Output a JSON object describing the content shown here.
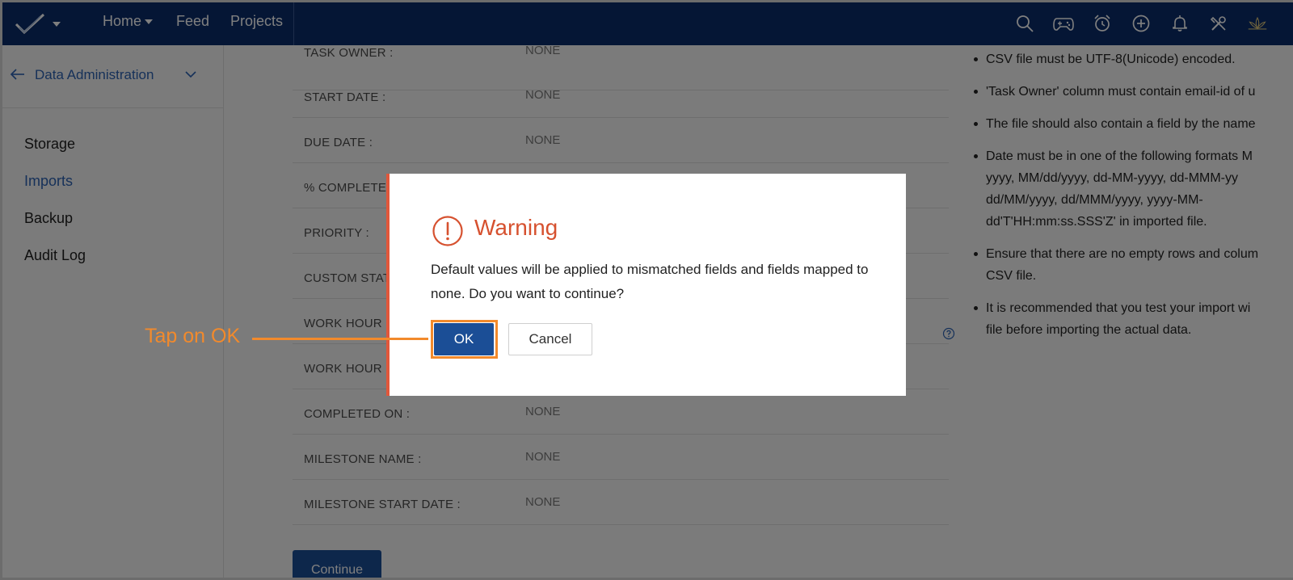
{
  "topnav": {
    "links": {
      "home": "Home",
      "feed": "Feed",
      "projects": "Projects"
    },
    "icons": [
      "search-icon",
      "gamepad-icon",
      "alarm-clock-icon",
      "add-circle-icon",
      "bell-icon",
      "tools-icon",
      "lotus-icon"
    ]
  },
  "sidebar": {
    "title": "Data Administration",
    "items": [
      "Storage",
      "Imports",
      "Backup",
      "Audit Log"
    ],
    "active": "Imports"
  },
  "fields": [
    {
      "label": "TASK OWNER :",
      "value": "NONE"
    },
    {
      "label": "START DATE :",
      "value": "NONE"
    },
    {
      "label": "DUE DATE :",
      "value": "NONE"
    },
    {
      "label": "% COMPLETE",
      "value": ""
    },
    {
      "label": "PRIORITY :",
      "value": ""
    },
    {
      "label": "CUSTOM STAT",
      "value": ""
    },
    {
      "label": "WORK HOUR",
      "value": ""
    },
    {
      "label": "WORK HOUR",
      "value": ""
    },
    {
      "label": "COMPLETED ON :",
      "value": "NONE"
    },
    {
      "label": "MILESTONE NAME :",
      "value": "NONE"
    },
    {
      "label": "MILESTONE START DATE :",
      "value": "NONE"
    }
  ],
  "continue_label": "Continue",
  "notes": [
    "CSV file must be UTF-8(Unicode) encoded.",
    "'Task Owner' column must contain email-id of u",
    "The file should also contain a field by the name",
    "Date must be in one of the following formats M\nyyyy, MM/dd/yyyy, dd-MM-yyyy, dd-MMM-yy\ndd/MM/yyyy, dd/MMM/yyyy, yyyy-MM-\ndd'T'HH:mm:ss.SSS'Z' in imported file.",
    "Ensure that there are no empty rows and colum\nCSV file.",
    "It is recommended that you test your import wi\nfile before importing the actual data."
  ],
  "dialog": {
    "title": "Warning",
    "message": "Default values will be applied to mismatched fields and fields mapped to none. Do you want to continue?",
    "ok_label": "OK",
    "cancel_label": "Cancel"
  },
  "callout": {
    "text": "Tap on OK"
  },
  "colors": {
    "nav": "#0b2c6b",
    "primary": "#1b4e96",
    "warning": "#d6512f",
    "callout": "#f28a2c"
  }
}
